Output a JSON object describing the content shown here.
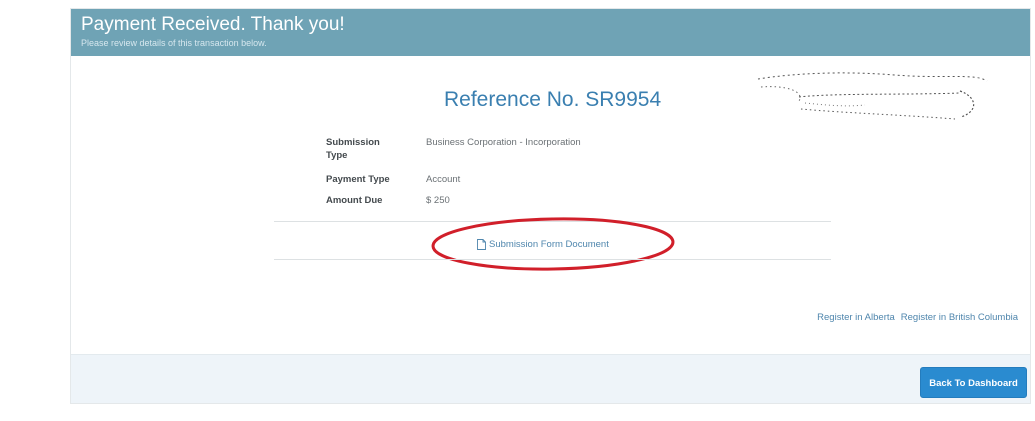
{
  "header": {
    "title": "Payment Received. Thank you!",
    "subtitle": "Please review details of this transaction below."
  },
  "reference": {
    "label": "Reference No. SR9954"
  },
  "details": [
    {
      "label": "Submission Type",
      "value": "Business Corporation - Incorporation"
    },
    {
      "label": "Payment Type",
      "value": "Account"
    },
    {
      "label": "Amount Due",
      "value": "$ 250"
    }
  ],
  "document_link": {
    "label": "Submission Form Document",
    "icon": "document-icon"
  },
  "register_links": {
    "alberta": "Register in Alberta",
    "british_columbia": "Register in British Columbia"
  },
  "footer": {
    "back_button": "Back To Dashboard"
  },
  "colors": {
    "header_bg": "#6fa3b5",
    "reference_text": "#3a7fb0",
    "link": "#4f86ad",
    "button_bg": "#2a8bd0",
    "annotation_circle": "#d11f2a"
  }
}
